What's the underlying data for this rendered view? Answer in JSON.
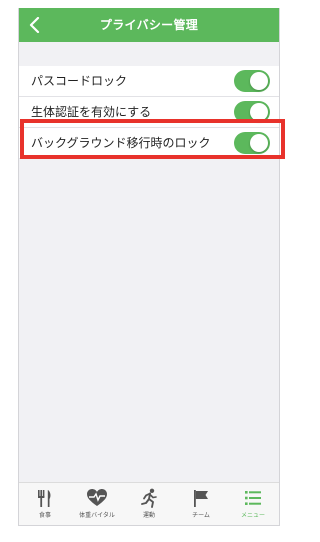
{
  "nav": {
    "title": "プライバシー管理",
    "back_icon": "chevron-left-icon"
  },
  "settings": [
    {
      "label": "パスコードロック",
      "enabled": true
    },
    {
      "label": "生体認証を有効にする",
      "enabled": true
    },
    {
      "label": "バックグラウンド移行時のロック",
      "enabled": true
    }
  ],
  "tabbar": {
    "tabs": [
      {
        "label": "食事",
        "icon": "fork-knife-icon",
        "active": false
      },
      {
        "label": "体重バイタル",
        "icon": "heart-pulse-icon",
        "active": false
      },
      {
        "label": "運動",
        "icon": "running-icon",
        "active": false
      },
      {
        "label": "チーム",
        "icon": "flag-icon",
        "active": false
      },
      {
        "label": "メニュー",
        "icon": "menu-list-icon",
        "active": true
      }
    ]
  },
  "colors": {
    "accent": "#5cb85c",
    "highlight": "#e8322b",
    "background": "#f1f1f4"
  }
}
